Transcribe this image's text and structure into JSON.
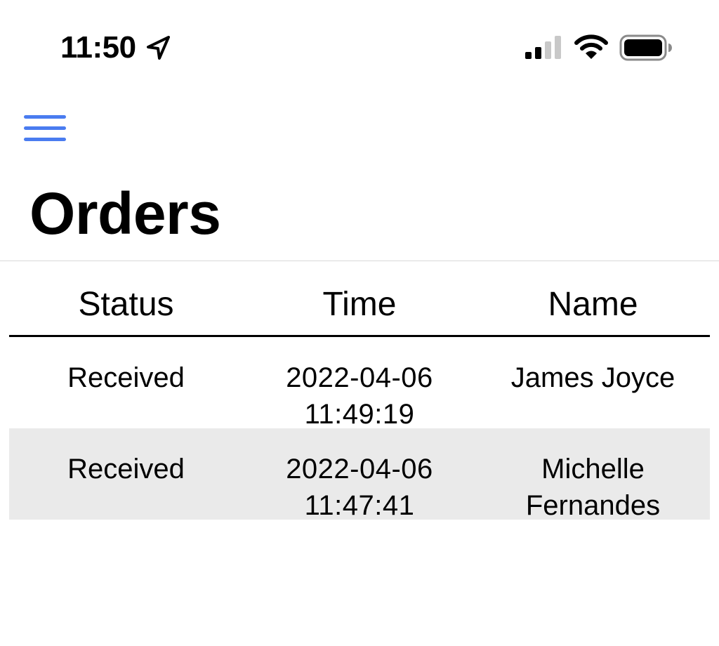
{
  "status_bar": {
    "time": "11:50",
    "location_icon": "location-arrow-icon",
    "signal_icon": "cellular-signal-icon",
    "wifi_icon": "wifi-icon",
    "battery_icon": "battery-icon"
  },
  "header": {
    "menu_icon": "hamburger-menu-icon",
    "accent_color": "#4a7cf0",
    "title": "Orders"
  },
  "table": {
    "columns": [
      "Status",
      "Time",
      "Name"
    ],
    "rows": [
      {
        "status": "Received",
        "date": "2022-04-06",
        "time": "11:49:19",
        "name_line1": "James Joyce",
        "name_line2": ""
      },
      {
        "status": "Received",
        "date": "2022-04-06",
        "time": "11:47:41",
        "name_line1": "Michelle",
        "name_line2": "Fernandes"
      }
    ],
    "alt_row_color": "#eaeaea"
  }
}
